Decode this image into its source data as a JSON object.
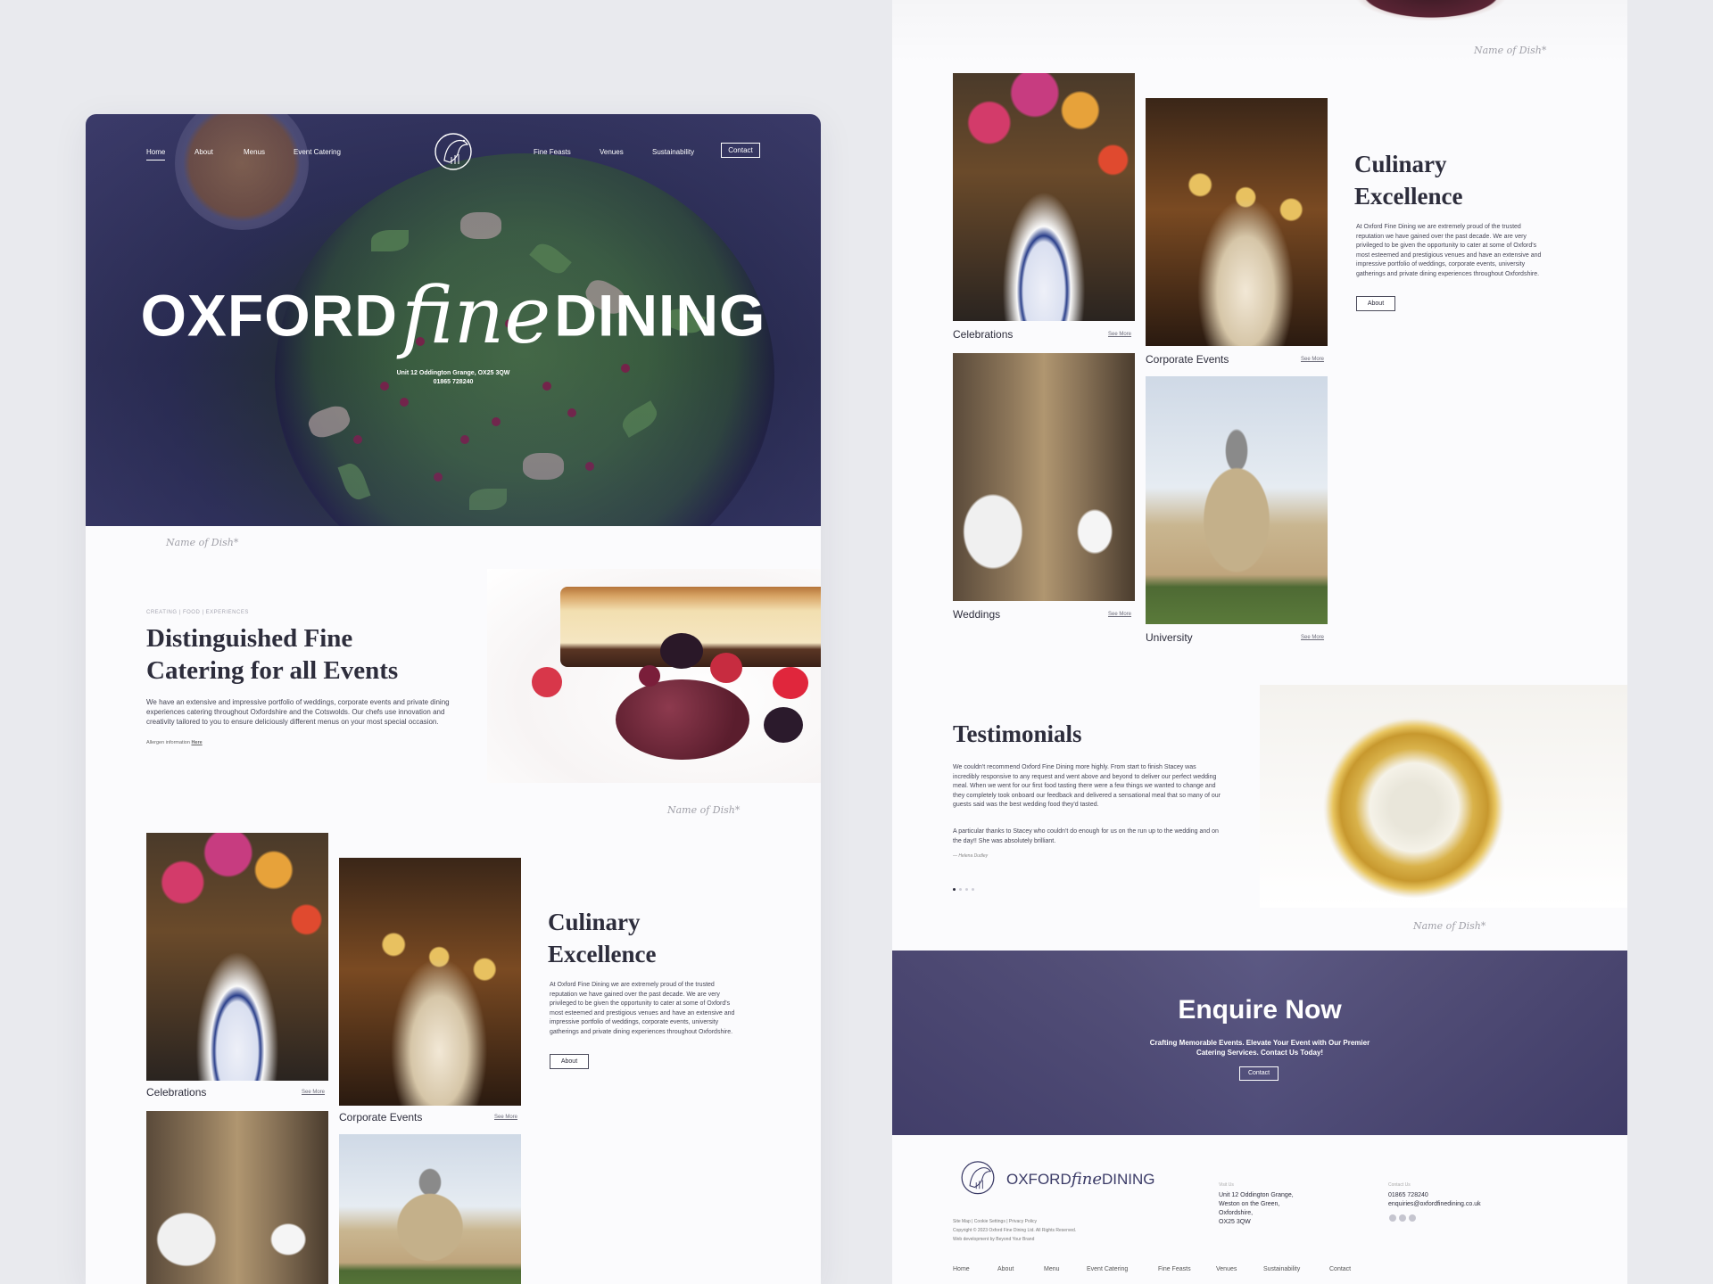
{
  "brand": {
    "name_left": "OXFORD",
    "name_script": "fine",
    "name_right": "DINING",
    "address_line1": "Unit 12 Oddington Grange, OX25 3QW",
    "phone": "01865 728240"
  },
  "nav": {
    "left": [
      "Home",
      "About",
      "Menus",
      "Event Catering"
    ],
    "right": [
      "Fine Feasts",
      "Venues",
      "Sustainability"
    ],
    "contact": "Contact"
  },
  "captions": {
    "dish": "Name of Dish*"
  },
  "intro": {
    "crumbs": "CREATING  |  FOOD  |  EXPERIENCES",
    "heading_line1": "Distinguished Fine",
    "heading_line2": "Catering for all Events",
    "body": "We have an extensive and impressive portfolio of weddings, corporate events and private dining experiences catering throughout Oxfordshire and the Cotswolds. Our chefs use innovation and creativity tailored to you to ensure deliciously different menus on your most special occasion.",
    "allergen_prefix": "Allergen information",
    "allergen_link": "Here"
  },
  "events": {
    "celebrations": "Celebrations",
    "corporate": "Corporate Events",
    "weddings": "Weddings",
    "university": "University",
    "see_more": "See More"
  },
  "culinary": {
    "heading_line1": "Culinary",
    "heading_line2": "Excellence",
    "body": "At Oxford Fine Dining we are extremely proud of the trusted reputation we have gained over the past decade. We are very privileged to be given the opportunity to cater at some of Oxford's most esteemed and prestigious venues and have an extensive and impressive portfolio of weddings, corporate events, university gatherings and private dining experiences throughout Oxfordshire.",
    "button": "About"
  },
  "testimonials": {
    "heading": "Testimonials",
    "quote1": "We couldn't recommend Oxford Fine Dining more highly. From start to finish Stacey was incredibly responsive to any request and went above and beyond to deliver our perfect wedding meal. When we went for our first food tasting there were a few things we wanted to change and they completely took onboard our feedback and delivered a sensational meal that so many of our guests said was the best wedding food they'd tasted.",
    "quote2": "A particular thanks to Stacey who couldn't do enough for us on the run up to the wedding and on the day!! She was absolutely brilliant.",
    "author": "— Helena Dudley"
  },
  "enquire": {
    "heading": "Enquire Now",
    "line1": "Crafting Memorable Events. Elevate Your Event with Our Premier",
    "line2": "Catering Services. Contact Us Today!",
    "button": "Contact"
  },
  "footer": {
    "links": "Site Map  |  Cookie Settings  |  Privacy Policy",
    "copyright": "Copyright © 2023 Oxford Fine Dining Ltd. All Rights Reserved.",
    "credit": "Web development by Beyond Your Brand",
    "visit_label": "Visit Us",
    "visit_lines": [
      "Unit 12 Oddington Grange,",
      "Weston on the Green,",
      "Oxfordshire,",
      "OX25 3QW"
    ],
    "contact_label": "Contact Us",
    "phone": "01865 728240",
    "email": "enquiries@oxfordfinedining.co.uk",
    "nav": [
      "Home",
      "About",
      "Menu",
      "Event Catering",
      "Fine Feasts",
      "Venues",
      "Sustainability",
      "Contact"
    ]
  },
  "icons": [
    "logo-bird-icon",
    "facebook-icon",
    "instagram-icon",
    "linkedin-icon"
  ],
  "colors": {
    "accent": "#3e3d74",
    "text": "#2d2d3c",
    "background": "#e9eaee"
  }
}
